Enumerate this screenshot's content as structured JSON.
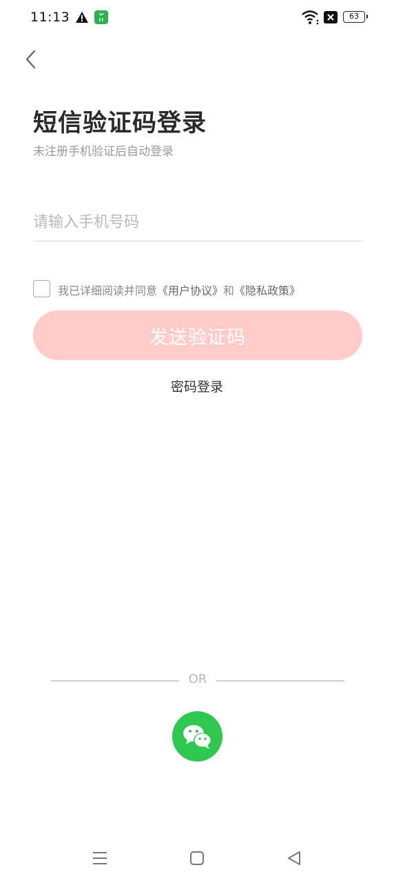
{
  "status_bar": {
    "time": "11:13",
    "battery_level": "63",
    "icons": [
      "warning-icon",
      "app-notification-icon",
      "wifi-icon",
      "sim-icon",
      "battery-icon"
    ]
  },
  "header": {
    "back_icon": "chevron-left-icon"
  },
  "main": {
    "title": "短信验证码登录",
    "subtitle": "未注册手机验证后自动登录",
    "phone_input": {
      "placeholder": "请输入手机号码",
      "value": ""
    },
    "agreement": {
      "checked": false,
      "prefix": "我已详细阅读并同意",
      "user_agreement": "《用户协议》",
      "conjunction": "和",
      "privacy_policy": "《隐私政策》"
    },
    "send_code_button": "发送验证码",
    "password_login_link": "密码登录",
    "accent_color": "#ffccca"
  },
  "footer": {
    "or_text": "OR",
    "wechat_login_icon": "wechat-icon",
    "wechat_color": "#2dc84d"
  },
  "nav_bar": {
    "icons": [
      "menu-icon",
      "home-icon",
      "back-icon"
    ]
  }
}
